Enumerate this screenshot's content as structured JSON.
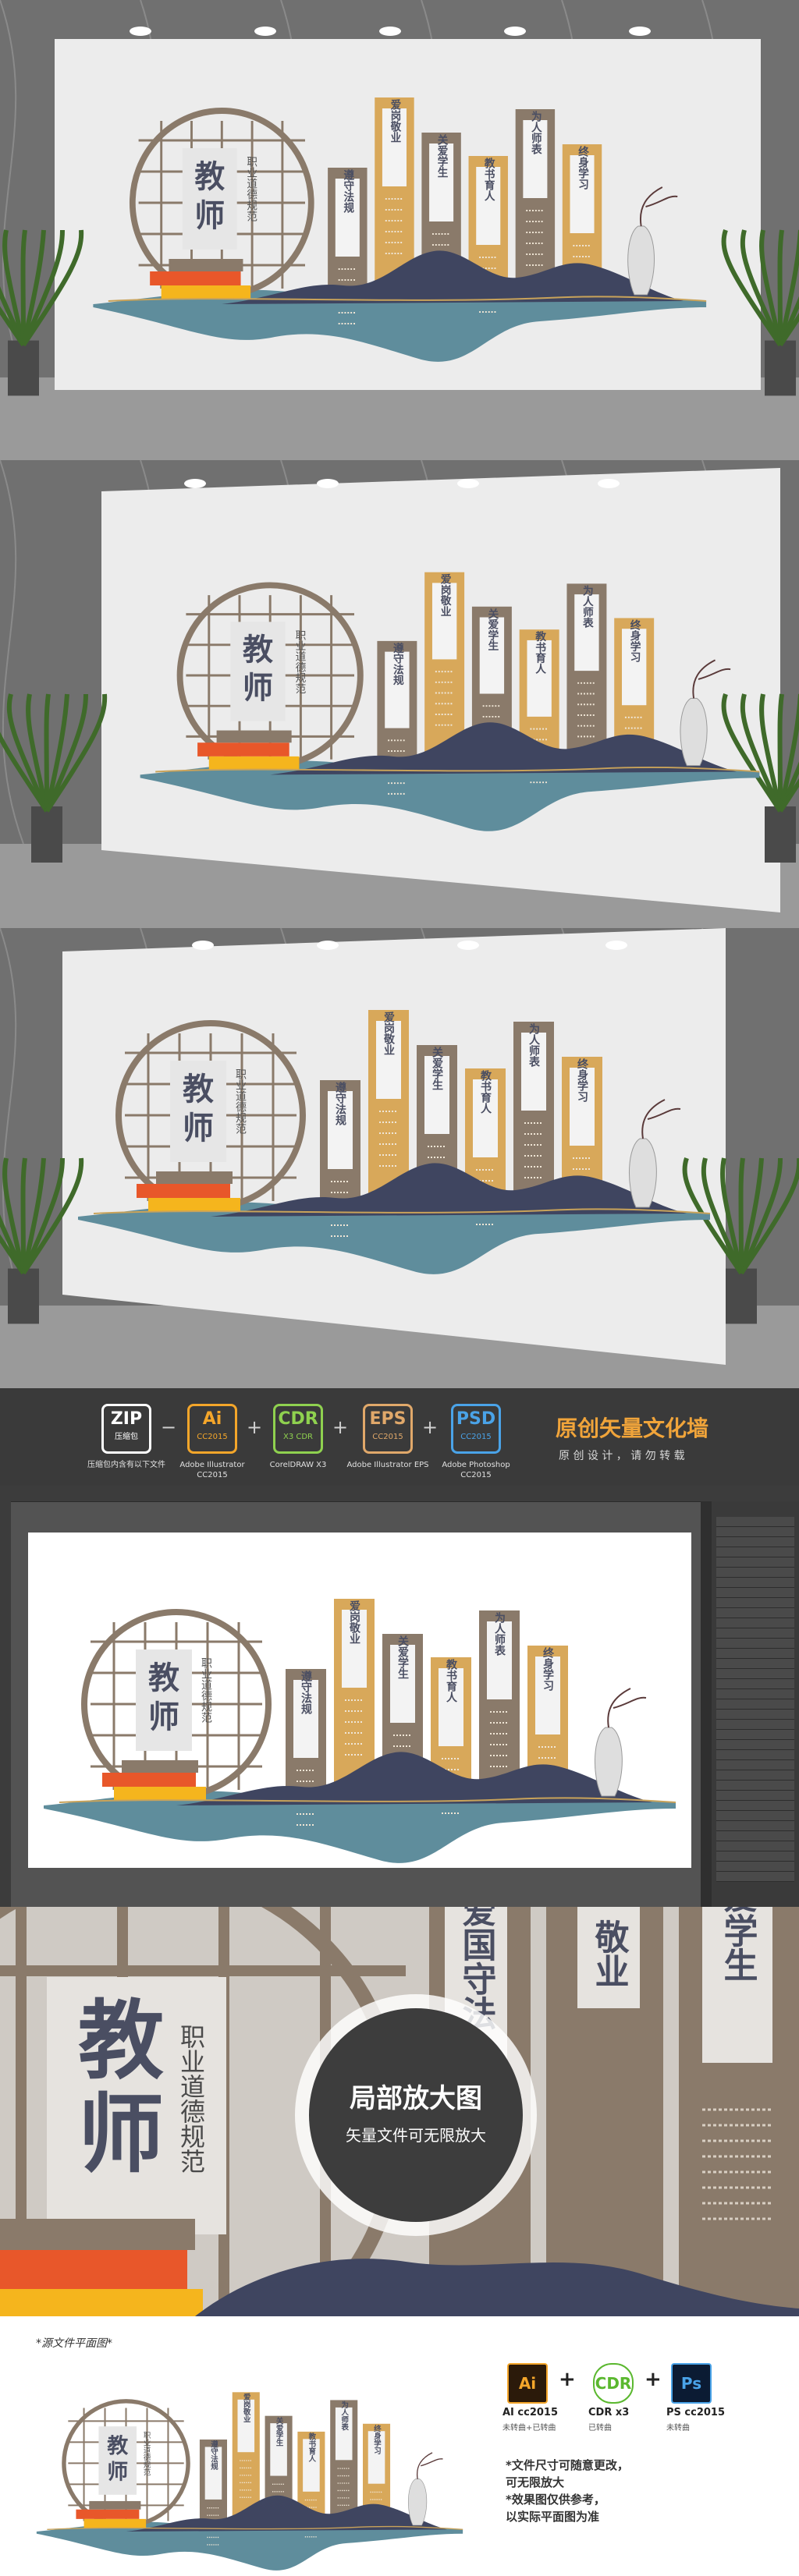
{
  "wall": {
    "title_chars": [
      "教",
      "师"
    ],
    "subtitle": "职业道德规范",
    "boards": [
      {
        "label": "遵守法规",
        "tall": 0.55,
        "color": "#8a7a6a"
      },
      {
        "label": "爱岗敬业",
        "tall": 0.85,
        "color": "#d8a85a"
      },
      {
        "label": "关爱学生",
        "tall": 0.7,
        "color": "#8a7a6a"
      },
      {
        "label": "教书育人",
        "tall": 0.6,
        "color": "#d8a85a"
      },
      {
        "label": "为人师表",
        "tall": 0.8,
        "color": "#8a7a6a"
      },
      {
        "label": "终身学习",
        "tall": 0.65,
        "color": "#d8a85a"
      }
    ],
    "colors": {
      "brown": "#8a7a6a",
      "gold": "#d8a85a",
      "navy": "#3f4560",
      "teal": "#5f8d9c",
      "orange": "#e8572a",
      "yellow": "#f5b51d"
    }
  },
  "format_bar": {
    "items": [
      {
        "name": "ZIP",
        "version": "压缩包",
        "caption": "压缩包内含有以下文件",
        "color": "#ffffff"
      },
      {
        "name": "Ai",
        "version": "CC2015",
        "caption": "Adobe Illustrator CC2015",
        "color": "#f4a62a"
      },
      {
        "name": "CDR",
        "version": "X3 CDR",
        "caption": "CorelDRAW X3",
        "color": "#8fd14f"
      },
      {
        "name": "EPS",
        "version": "CC2015",
        "caption": "Adobe Illustrator EPS",
        "color": "#e0a86a"
      },
      {
        "name": "PSD",
        "version": "CC2015",
        "caption": "Adobe Photoshop CC2015",
        "color": "#4aa3e8"
      }
    ],
    "separators": [
      "−",
      "+",
      "+",
      "+"
    ],
    "headline": "原创矢量文化墙",
    "subline": "原 创 设 计 ， 请 勿 转 载"
  },
  "zoom": {
    "badge_title": "局部放大图",
    "badge_sub": "矢量文件可无限放大",
    "chars": [
      "教",
      "师"
    ],
    "subtitle": "职业道德规范",
    "board_texts": [
      "爱国守法",
      "敬业",
      "爱学生"
    ]
  },
  "bottom": {
    "caption": "*源文件平面图*",
    "sw_items": [
      {
        "name": "Ai",
        "label": "AI cc2015",
        "sub": "未转曲+已转曲"
      },
      {
        "name": "CDR",
        "label": "CDR x3",
        "sub": "已转曲"
      },
      {
        "name": "Ps",
        "label": "PS cc2015",
        "sub": "未转曲"
      }
    ],
    "notes": [
      "*文件尺寸可随意更改，",
      "可无限放大",
      "*效果图仅供参考，",
      "以实际平面图为准"
    ]
  }
}
